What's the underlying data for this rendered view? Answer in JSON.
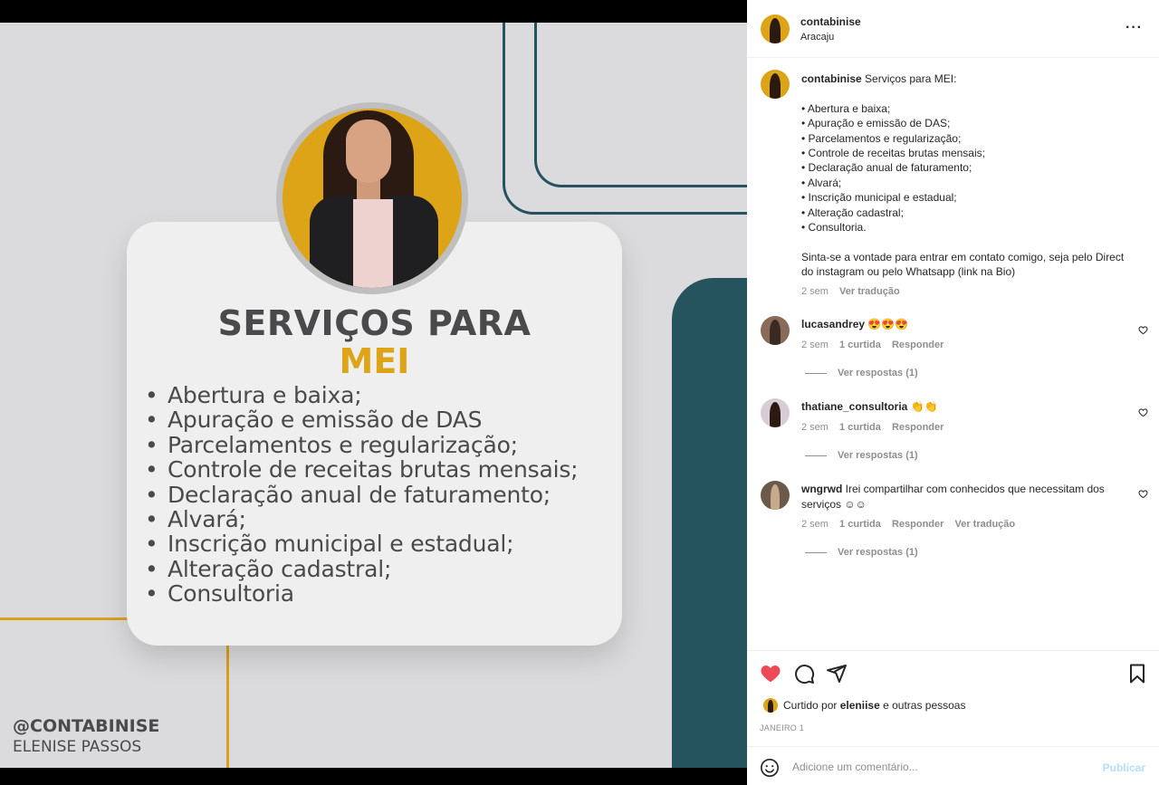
{
  "post_image": {
    "title": "SERVIÇOS PARA",
    "title_accent": "MEI",
    "items": [
      "Abertura e baixa;",
      "Apuração e emissão de DAS",
      "Parcelamentos e regularização;",
      "Controle de receitas brutas mensais;",
      "Declaração anual de faturamento;",
      "Alvará;",
      "Inscrição municipal e estadual;",
      "Alteração cadastral;",
      "Consultoria"
    ],
    "handle": "@CONTABINISE",
    "name": "ELENISE PASSOS",
    "colors": {
      "accent": "#dea418",
      "teal": "#26545e",
      "text": "#4a4a4c"
    }
  },
  "header": {
    "username": "contabinise",
    "location": "Aracaju",
    "more_icon": "···"
  },
  "caption": {
    "username": "contabinise",
    "text_lines": [
      "Serviços para MEI:",
      "",
      "• Abertura e baixa;",
      "• Apuração e emissão de DAS;",
      "• Parcelamentos e regularização;",
      "• Controle de receitas brutas mensais;",
      "• Declaração anual de faturamento;",
      "• Alvará;",
      "• Inscrição municipal e estadual;",
      "• Alteração cadastral;",
      "• Consultoria.",
      "",
      "Sinta-se a vontade para entrar em contato comigo, seja pelo Direct do instagram ou pelo Whatsapp (link na Bio)"
    ],
    "time": "2 sem",
    "translate": "Ver tradução"
  },
  "comments": [
    {
      "username": "lucasandrey",
      "text": "😍😍😍",
      "time": "2 sem",
      "likes": "1 curtida",
      "reply": "Responder",
      "translate": "",
      "view_replies": "Ver respostas (1)"
    },
    {
      "username": "thatiane_consultoria",
      "text": "👏👏",
      "time": "2 sem",
      "likes": "1 curtida",
      "reply": "Responder",
      "translate": "",
      "view_replies": "Ver respostas (1)"
    },
    {
      "username": "wngrwd",
      "text": "Irei compartilhar com conhecidos que necessitam dos serviços ☺☺",
      "time": "2 sem",
      "likes": "1 curtida",
      "reply": "Responder",
      "translate": "Ver tradução",
      "view_replies": "Ver respostas (1)"
    }
  ],
  "actions": {
    "liked_by_prefix": "Curtido por",
    "liked_by_user": "eleniise",
    "liked_by_suffix": "e outras pessoas",
    "date": "JANEIRO 1",
    "like_color": "#ed4956"
  },
  "add_comment": {
    "placeholder": "Adicione um comentário...",
    "publish": "Publicar"
  }
}
